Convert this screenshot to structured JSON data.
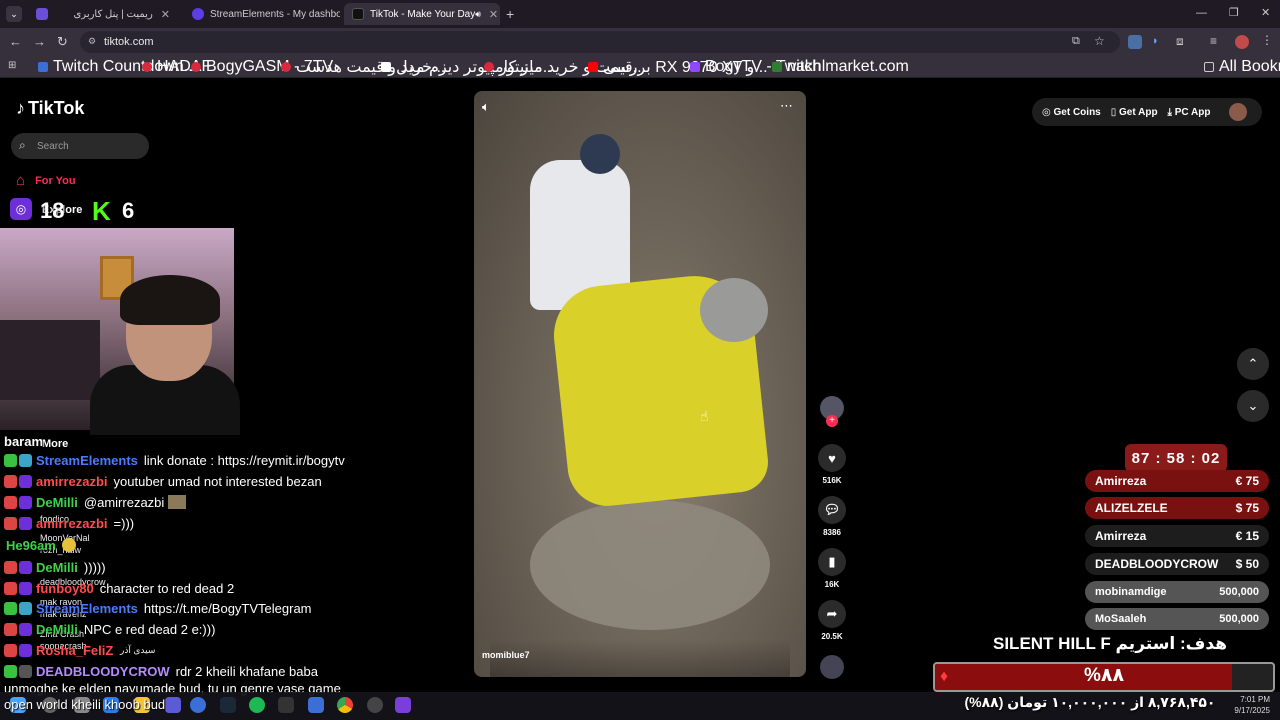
{
  "tabs": [
    {
      "title": "ریمیت | پنل کاربری",
      "icon": "reymit-icon",
      "color": "#6b4fd8",
      "active": false
    },
    {
      "title": "StreamElements - My dashboard",
      "icon": "streamelements-icon",
      "color": "#5b3ee8",
      "active": false
    },
    {
      "title": "TikTok - Make Your Day",
      "icon": "tiktok-icon",
      "color": "#111111",
      "active": true
    }
  ],
  "address": "tiktok.com",
  "bookmarks": [
    {
      "label": "Twitch Countdown...",
      "color": "#3b6fd6"
    },
    {
      "label": "HADAF",
      "color": "#d92a3d"
    },
    {
      "label": "BogyGASM - 7TV",
      "color": "#d92a3d"
    },
    {
      "label": "خرید و قیمت هدست...",
      "color": "#d92a3d"
    },
    {
      "label": "میز کامپیوتر دیزم مدل...",
      "color": "#ffffff"
    },
    {
      "label": "قیمت و خرید مانیتور...",
      "color": "#d92a3d"
    },
    {
      "label": "بررسی RX 9070 XT و...",
      "color": "#ff0000"
    },
    {
      "label": "BogyTV - Twitch",
      "color": "#9146ff"
    },
    {
      "label": "nakhlmarket.com",
      "color": "#2e7d32"
    }
  ],
  "all_bookmarks": "All Bookmarks",
  "tiktok": {
    "logo": "TikTok",
    "search_placeholder": "Search",
    "for_you": "For You",
    "explore": "Explore",
    "more": "More",
    "get_coins": "Get Coins",
    "get_app": "Get App",
    "pc_app": "PC App",
    "video_user": "momiblue7",
    "likes": "516K",
    "comments": "8386",
    "saves": "16K",
    "shares": "20.5K"
  },
  "overlay": {
    "counter_left": "18",
    "counter_right": "6",
    "chat_top_user": "baram",
    "chat": [
      {
        "name": "StreamElements",
        "name_color": "#4a7cff",
        "msg": "link donate : https://reymit.ir/bogytv"
      },
      {
        "name": "amirrezazbi",
        "name_color": "#ff4d4d",
        "msg": "youtuber umad not interested bezan"
      },
      {
        "name": "DeMilli",
        "name_color": "#3fd14a",
        "msg": "@amirrezazbi"
      },
      {
        "name": "amirrezazbi",
        "name_color": "#ff4d4d",
        "msg": "=)))"
      },
      {
        "name": "He96am",
        "name_color": "#3fd14a",
        "msg": ""
      },
      {
        "name": "DeMilli",
        "name_color": "#3fd14a",
        "msg": ")))))"
      },
      {
        "name": "funboy80",
        "name_color": "#ff4d4d",
        "msg": "character to red dead 2"
      },
      {
        "name": "StreamElements",
        "name_color": "#4a7cff",
        "msg": "https://t.me/BogyTVTelegram"
      },
      {
        "name": "DeMilli",
        "name_color": "#3fd14a",
        "msg": "NPC e red dead 2 e:)))"
      },
      {
        "name": "Rosha_FeliZ",
        "name_color": "#ff4d4d",
        "msg": ""
      },
      {
        "name": "DEADBLOODYCROW",
        "name_color": "#b58cff",
        "msg": "rdr 2 kheili khafane baba"
      }
    ],
    "chat_tail_1": "unmoghe ke elden nayumade bud, tu un genre vase game",
    "chat_tail_2": "open world kheili khoob bud",
    "ghost_lines": [
      "foodico",
      "MoonVerNal",
      "rozh_nalw",
      "deadbloodycrow",
      "mak ravon",
      "mak ravenz",
      "Zina Crash",
      "soonacrash",
      "سیدی آذر"
    ],
    "timer": "87 : 58 : 02",
    "donations": [
      {
        "name": "Amirreza",
        "amount": "€ 75",
        "style": "red"
      },
      {
        "name": "ALIZELZELE",
        "amount": "$ 75",
        "style": "red"
      },
      {
        "name": "Amirreza",
        "amount": "€ 15",
        "style": "dark"
      },
      {
        "name": "DEADBLOODYCROW",
        "amount": "$ 50",
        "style": "dark"
      },
      {
        "name": "mobinamdige",
        "amount": "500,000",
        "style": "grey"
      },
      {
        "name": "MoSaaleh",
        "amount": "500,000",
        "style": "grey"
      }
    ],
    "goal_title": "هدف: استریم SILENT HILL F",
    "goal_percent": "%۸۸",
    "goal_fraction": 0.88,
    "goal_sub": "۸,۷۶۸,۴۵۰ از ۱۰,۰۰۰,۰۰۰ تومان (۸۸%)"
  },
  "clock": {
    "time": "7:01 PM",
    "date": "9/17/2025"
  }
}
